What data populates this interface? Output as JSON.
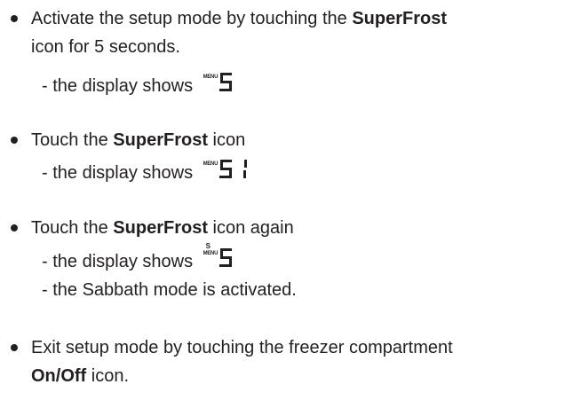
{
  "steps": [
    {
      "text_before": "Activate the setup mode by touching the ",
      "bold": "SuperFrost",
      "text_after": "",
      "line2": "icon for 5 seconds.",
      "sub": [
        {
          "text": "- the display shows",
          "display": {
            "menu": "MENU",
            "top": "",
            "digits": "5"
          }
        }
      ]
    },
    {
      "text_before": "Touch the ",
      "bold": "SuperFrost",
      "text_after": " icon",
      "sub": [
        {
          "text": "- the display shows",
          "display": {
            "menu": "MENU",
            "top": "",
            "digits": "51"
          }
        }
      ]
    },
    {
      "text_before": "Touch the ",
      "bold": "SuperFrost",
      "text_after": " icon again",
      "sub": [
        {
          "text": "- the display shows",
          "display": {
            "menu": "MENU",
            "top": "S",
            "digits": "5"
          }
        },
        {
          "text": "- the Sabbath mode is activated."
        }
      ]
    },
    {
      "text_before": "Exit setup mode by touching the freezer compartment",
      "bold": "On/Off",
      "text_after": " icon."
    }
  ],
  "colors": {
    "text": "#231f20",
    "background": "#ffffff"
  },
  "icons": [
    "bullet-icon",
    "seven-segment-display-icon"
  ]
}
